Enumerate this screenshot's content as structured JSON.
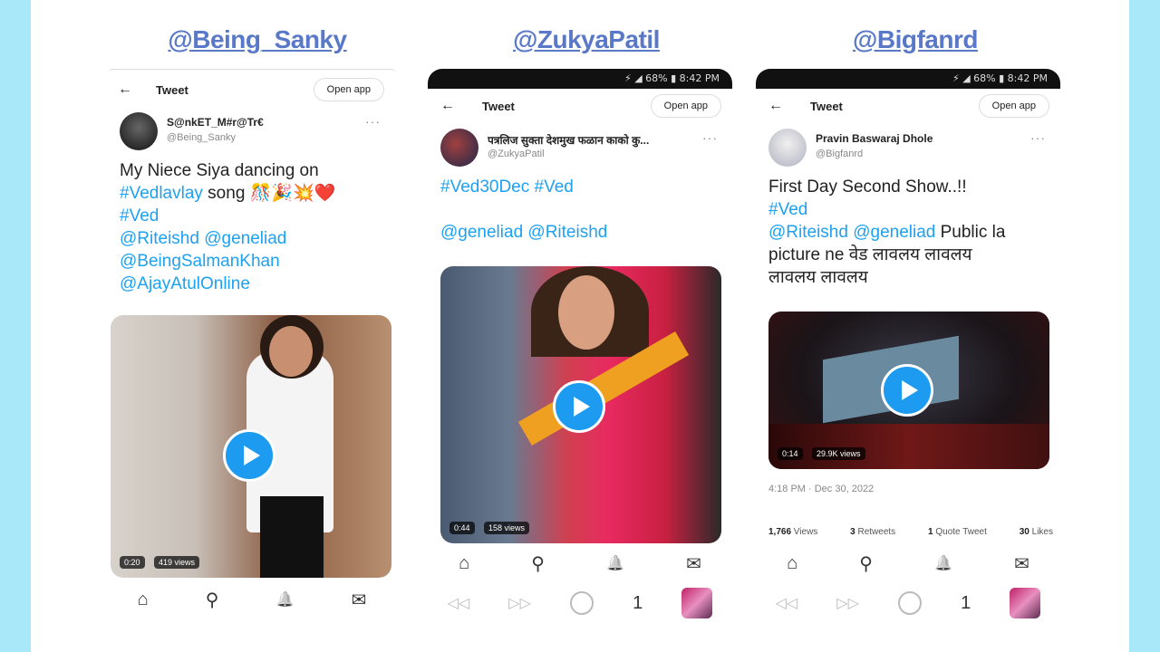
{
  "handles": [
    "@Being_Sanky",
    "@ZukyaPatil",
    "@Bigfanrd"
  ],
  "phones": [
    {
      "status": "",
      "header_title": "Tweet",
      "open_app": "Open app",
      "author_name": "S@nkET_M#r@Tr€",
      "author_handle": "@Being_Sanky",
      "tweet_lines": [
        [
          {
            "t": "My Niece Siya dancing on",
            "link": false
          }
        ],
        [
          {
            "t": "#Vedlavlay",
            "link": true
          },
          {
            "t": " song 🎊🎉💥❤️",
            "link": false
          }
        ],
        [
          {
            "t": "#Ved",
            "link": true
          }
        ],
        [
          {
            "t": "@Riteishd @geneliad",
            "link": true
          }
        ],
        [
          {
            "t": "@BeingSalmanKhan",
            "link": true
          }
        ],
        [
          {
            "t": "@AjayAtulOnline",
            "link": true
          }
        ]
      ],
      "video_time": "0:20",
      "video_views": "419 views"
    },
    {
      "status": "⚡ ◢ 68% ▮ 8:42 PM",
      "header_title": "Tweet",
      "open_app": "Open app",
      "author_name": "पत्रलिज सुक्ता देशमुख फळान काको कु...",
      "author_handle": "@ZukyaPatil",
      "tweet_lines": [
        [
          {
            "t": "#Ved30Dec #Ved",
            "link": true
          }
        ],
        [
          {
            "t": " ",
            "link": false
          }
        ],
        [
          {
            "t": "@geneliad @Riteishd",
            "link": true
          }
        ]
      ],
      "video_time": "0:44",
      "video_views": "158 views",
      "tab_count": "1"
    },
    {
      "status": "⚡ ◢ 68% ▮ 8:42 PM",
      "header_title": "Tweet",
      "open_app": "Open app",
      "author_name": "Pravin Baswaraj Dhole",
      "author_handle": "@Bigfanrd",
      "tweet_lines": [
        [
          {
            "t": "First Day Second Show..!!",
            "link": false
          }
        ],
        [
          {
            "t": "#Ved",
            "link": true
          }
        ],
        [
          {
            "t": "@Riteishd @geneliad",
            "link": true
          },
          {
            "t": "  Public la",
            "link": false
          }
        ],
        [
          {
            "t": "picture ne वेड लावलय लावलय",
            "link": false
          }
        ],
        [
          {
            "t": "लावलय लावलय",
            "link": false
          }
        ]
      ],
      "video_time": "0:14",
      "video_views": "29.9K views",
      "timestamp": "4:18 PM · Dec 30, 2022",
      "stats": [
        {
          "num": "1,766",
          "label": " Views"
        },
        {
          "num": "3",
          "label": " Retweets"
        },
        {
          "num": "1",
          "label": " Quote Tweet"
        },
        {
          "num": "30",
          "label": " Likes"
        }
      ],
      "tab_count": "1"
    }
  ],
  "icons": {
    "back": "←",
    "more": "···",
    "home": "⌂",
    "search": "⚲",
    "bell": "🔔",
    "mail": "✉",
    "browser_back": "◁◁",
    "browser_forward": "▷▷"
  }
}
